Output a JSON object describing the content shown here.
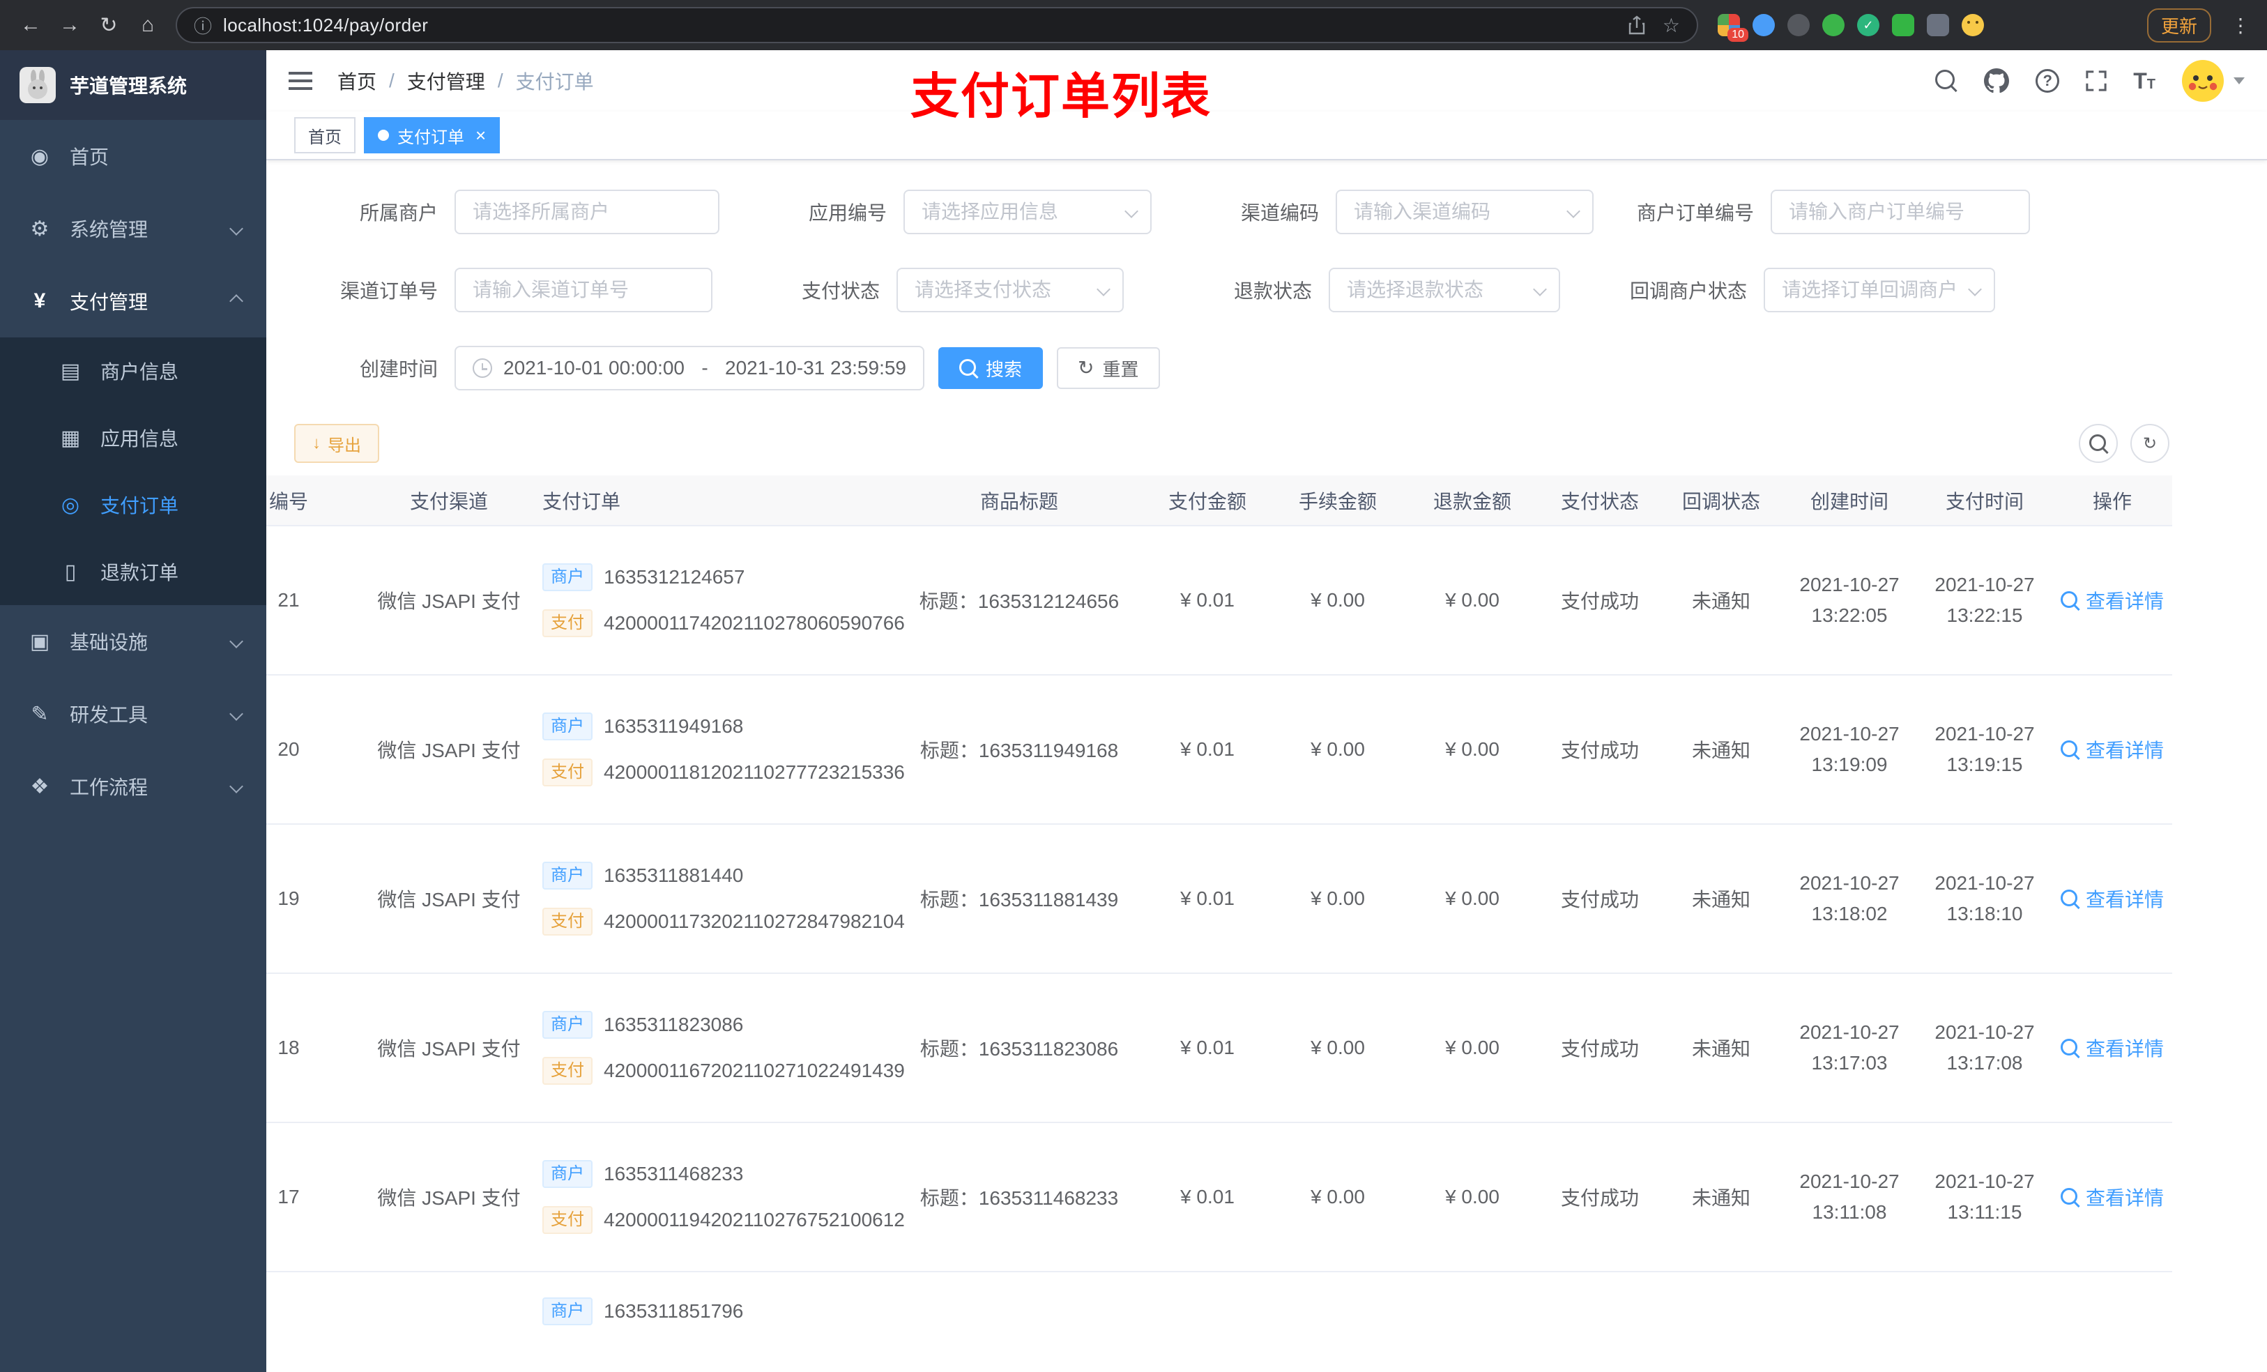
{
  "browser": {
    "url": "localhost:1024/pay/order",
    "update_label": "更新",
    "extension_badge": "10"
  },
  "sidebar": {
    "logo_title": "芋道管理系统",
    "items": [
      {
        "label": "首页"
      },
      {
        "label": "系统管理"
      },
      {
        "label": "支付管理"
      },
      {
        "label": "商户信息"
      },
      {
        "label": "应用信息"
      },
      {
        "label": "支付订单"
      },
      {
        "label": "退款订单"
      },
      {
        "label": "基础设施"
      },
      {
        "label": "研发工具"
      },
      {
        "label": "工作流程"
      }
    ]
  },
  "navbar": {
    "breadcrumb": {
      "home": "首页",
      "section": "支付管理",
      "current": "支付订单",
      "separator": "/"
    },
    "overlay_title": "支付订单列表"
  },
  "tags": {
    "home": "首页",
    "current": "支付订单"
  },
  "filters": {
    "merchant": {
      "label": "所属商户",
      "placeholder": "请选择所属商户"
    },
    "app": {
      "label": "应用编号",
      "placeholder": "请选择应用信息"
    },
    "channel_code": {
      "label": "渠道编码",
      "placeholder": "请输入渠道编码"
    },
    "merchant_order_no": {
      "label": "商户订单编号",
      "placeholder": "请输入商户订单编号"
    },
    "channel_order_no": {
      "label": "渠道订单号",
      "placeholder": "请输入渠道订单号"
    },
    "pay_status": {
      "label": "支付状态",
      "placeholder": "请选择支付状态"
    },
    "refund_status": {
      "label": "退款状态",
      "placeholder": "请选择退款状态"
    },
    "notify_status": {
      "label": "回调商户状态",
      "placeholder": "请选择订单回调商户状态"
    },
    "create_time": {
      "label": "创建时间",
      "start": "2021-10-01 00:00:00",
      "separator": "-",
      "end": "2021-10-31 23:59:59"
    },
    "search_label": "搜索",
    "reset_label": "重置"
  },
  "toolbar": {
    "export_label": "导出"
  },
  "table": {
    "columns": [
      "编号",
      "支付渠道",
      "支付订单",
      "商品标题",
      "支付金额",
      "手续金额",
      "退款金额",
      "支付状态",
      "回调状态",
      "创建时间",
      "支付时间",
      "操作"
    ],
    "merchant_tag": "商户",
    "pay_tag": "支付",
    "action_label": "查看详情",
    "rows": [
      {
        "id": "21",
        "channel": "微信 JSAPI 支付",
        "merchant_no": "1635312124657",
        "pay_no": "4200001174202110278060590766",
        "title": "标题：1635312124656",
        "amount": "¥ 0.01",
        "fee": "¥ 0.00",
        "refund": "¥ 0.00",
        "status": "支付成功",
        "notify": "未通知",
        "create_date": "2021-10-27",
        "create_time": "13:22:05",
        "pay_date": "2021-10-27",
        "pay_time": "13:22:15"
      },
      {
        "id": "20",
        "channel": "微信 JSAPI 支付",
        "merchant_no": "1635311949168",
        "pay_no": "4200001181202110277723215336",
        "title": "标题：1635311949168",
        "amount": "¥ 0.01",
        "fee": "¥ 0.00",
        "refund": "¥ 0.00",
        "status": "支付成功",
        "notify": "未通知",
        "create_date": "2021-10-27",
        "create_time": "13:19:09",
        "pay_date": "2021-10-27",
        "pay_time": "13:19:15"
      },
      {
        "id": "19",
        "channel": "微信 JSAPI 支付",
        "merchant_no": "1635311881440",
        "pay_no": "4200001173202110272847982104",
        "title": "标题：1635311881439",
        "amount": "¥ 0.01",
        "fee": "¥ 0.00",
        "refund": "¥ 0.00",
        "status": "支付成功",
        "notify": "未通知",
        "create_date": "2021-10-27",
        "create_time": "13:18:02",
        "pay_date": "2021-10-27",
        "pay_time": "13:18:10"
      },
      {
        "id": "18",
        "channel": "微信 JSAPI 支付",
        "merchant_no": "1635311823086",
        "pay_no": "4200001167202110271022491439",
        "title": "标题：1635311823086",
        "amount": "¥ 0.01",
        "fee": "¥ 0.00",
        "refund": "¥ 0.00",
        "status": "支付成功",
        "notify": "未通知",
        "create_date": "2021-10-27",
        "create_time": "13:17:03",
        "pay_date": "2021-10-27",
        "pay_time": "13:17:08"
      },
      {
        "id": "17",
        "channel": "微信 JSAPI 支付",
        "merchant_no": "1635311468233",
        "pay_no": "4200001194202110276752100612",
        "title": "标题：1635311468233",
        "amount": "¥ 0.01",
        "fee": "¥ 0.00",
        "refund": "¥ 0.00",
        "status": "支付成功",
        "notify": "未通知",
        "create_date": "2021-10-27",
        "create_time": "13:11:08",
        "pay_date": "2021-10-27",
        "pay_time": "13:11:15"
      }
    ],
    "partial_row": {
      "merchant_no": "1635311851796"
    }
  },
  "colors": {
    "accent": "#409eff",
    "warning": "#e6a23c",
    "annotation_red": "#ff0000",
    "sidebar_bg": "#304156",
    "submenu_bg": "#1f2d3d",
    "tag_blue_bg": "#ecf5ff",
    "tag_warn_bg": "#fdf6ec"
  }
}
